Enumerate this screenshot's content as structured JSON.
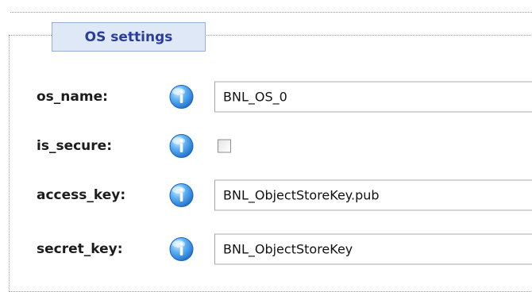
{
  "section": {
    "legend": "OS settings"
  },
  "fields": [
    {
      "label": "os_name:",
      "type": "text",
      "value": "BNL_OS_0"
    },
    {
      "label": "is_secure:",
      "type": "checkbox",
      "checked": false
    },
    {
      "label": "access_key:",
      "type": "text",
      "value": "BNL_ObjectStoreKey.pub"
    },
    {
      "label": "secret_key:",
      "type": "text",
      "value": "BNL_ObjectStoreKey"
    }
  ],
  "icons": {
    "info": "info-icon"
  },
  "colors": {
    "legend_text": "#2b3d9c",
    "legend_bg": "#dfe8f6",
    "info_blue": "#2f8fe6"
  }
}
